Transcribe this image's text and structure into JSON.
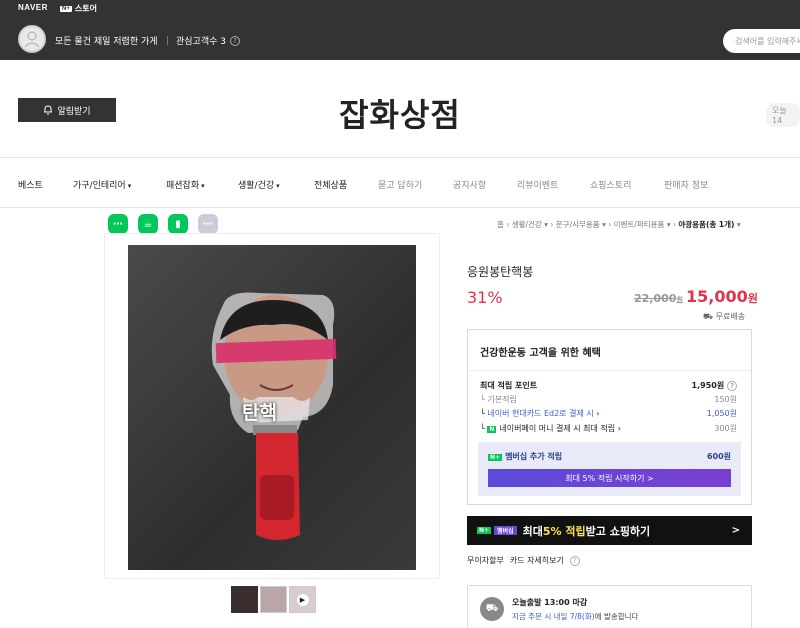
{
  "topbar": {
    "brand": "NAVER",
    "store_badge": "N+",
    "store_label": "스토어",
    "seller_name": "모든 물건 제일 저렴한 가게",
    "favorite_label": "관심고객수 3",
    "search_placeholder": "검색어를 입력해주세요"
  },
  "hero": {
    "alarm_label": "알림받기",
    "store_title": "잡화상점",
    "today_label": "오늘 14"
  },
  "nav": {
    "items": [
      {
        "label": "베스트"
      },
      {
        "label": "가구/인테리어"
      },
      {
        "label": "패션잡화"
      },
      {
        "label": "생활/건강"
      },
      {
        "label": "전체상품"
      },
      {
        "label": "묻고 답하기"
      },
      {
        "label": "공지사항"
      },
      {
        "label": "리뷰이벤트"
      },
      {
        "label": "쇼핑스토리"
      },
      {
        "label": "판매자 정보"
      }
    ]
  },
  "breadcrumb": {
    "home": "홈",
    "c1": "생활/건강",
    "c2": "문구/사무용품",
    "c3": "이벤트/파티용품",
    "c4": "야광용품(총 1개)"
  },
  "product": {
    "name": "응원봉탄핵봉",
    "discount": "31%",
    "original_price": "22,000",
    "original_unit": "원",
    "price": "15,000",
    "price_unit": "원",
    "shipping": "무료배송",
    "photo_text": "탄핵"
  },
  "benefit": {
    "title": "건강한운동 고객을 위한 혜택",
    "max_points_label": "최대 적립 포인트",
    "max_points_value": "1,950원",
    "basic_label": "기본적립",
    "basic_value": "150원",
    "card_label": "네이버 현대카드 Ed2로 결제 시",
    "card_value": "1,050원",
    "pay_label": "네이버페이 머니 결제 시 최대 적립",
    "pay_value": "300원",
    "membership_label": "멤버십 추가 적립",
    "membership_value": "600원",
    "membership_button": "최대 5% 적립 시작하기 >"
  },
  "banner": {
    "badge": "멤버십",
    "text_pre": "최대 ",
    "text_hl": "5% 적립",
    "text_post": " 받고 쇼핑하기",
    "arrow": ">"
  },
  "interest": {
    "label1": "무이자할부",
    "label2": "카드 자세히보기"
  },
  "delivery": {
    "title": "오늘출발 13:00 마감",
    "detail_hl": "지금 주문 시 내일 7/8(화)",
    "detail_rest": "에 발송합니다"
  },
  "colors": {
    "accent_red": "#e0344c",
    "naver_green": "#03c75a",
    "membership_purple": "#6a46d6",
    "link_blue": "#3d5ed8"
  }
}
